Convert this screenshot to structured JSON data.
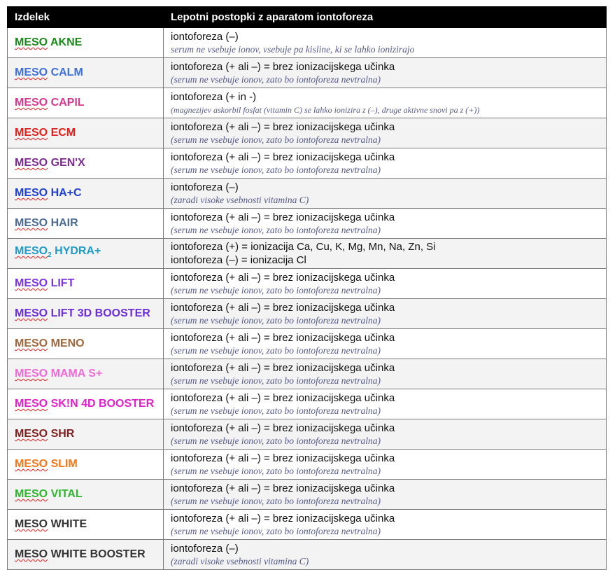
{
  "headers": {
    "col1": "Izdelek",
    "col2": "Lepotni postopki z aparatom iontoforeza"
  },
  "rows": [
    {
      "prefix": "MESO",
      "name": " AKNE",
      "color": "#1b8a1b",
      "line1": "iontoforeza (–)",
      "line2": "serum ne vsebuje ionov, vsebuje pa kisline, ki se lahko ionizirajo",
      "style": "plain"
    },
    {
      "prefix": "MESO",
      "name": " CALM",
      "color": "#3f6fd8",
      "line1": "iontoforeza (+ ali –) = brez ionizacijskega učinka",
      "line2": "(serum ne vsebuje ionov, zato bo iontoforeza nevtralna)",
      "style": "ital"
    },
    {
      "prefix": "MESO",
      "name": " CAPIL",
      "color": "#d6388f",
      "line1": "iontoforeza (+ in -)",
      "line2": "(magnezijev askorbil fosfat (vitamin C) se lahko ionizira z (–), druge aktivne snovi pa z (+))",
      "style": "small"
    },
    {
      "prefix": "MESO",
      "name": " ECM",
      "color": "#e0231d",
      "line1": "iontoforeza (+ ali –) = brez ionizacijskega učinka",
      "line2": "(serum ne vsebuje ionov, zato bo iontoforeza nevtralna)",
      "style": "ital"
    },
    {
      "prefix": "MESO",
      "name": " GEN'X",
      "color": "#7b2a8f",
      "line1": "iontoforeza (+ ali –) = brez ionizacijskega učinka",
      "line2": "(serum ne vsebuje ionov, zato bo iontoforeza nevtralna)",
      "style": "ital"
    },
    {
      "prefix": "MESO",
      "name": " HA+C",
      "color": "#1f3fd1",
      "line1": "iontoforeza (–)",
      "line2": "(zaradi visoke vsebnosti vitamina C)",
      "style": "ital"
    },
    {
      "prefix": "MESO",
      "name": " HAIR",
      "color": "#4a6b93",
      "line1": "iontoforeza (+ ali –) = brez ionizacijskega učinka",
      "line2": "(serum ne vsebuje ionov, zato bo iontoforeza nevtralna)",
      "style": "ital"
    },
    {
      "prefix": "MESO",
      "sub": "2",
      "name": " HYDRA+",
      "color": "#1f9bc6",
      "line1": "iontoforeza (+) = ionizacija Ca, Cu, K, Mg, Mn, Na, Zn, Si",
      "line2": "iontoforeza (–) = ionizacija Cl",
      "style": "normal"
    },
    {
      "prefix": "MESO",
      "name": " LIFT",
      "color": "#7a35e0",
      "line1": "iontoforeza (+ ali –) = brez ionizacijskega učinka",
      "line2": "(serum ne vsebuje ionov, zato bo iontoforeza nevtralna)",
      "style": "ital"
    },
    {
      "prefix": "MESO",
      "name": " LIFT 3D BOOSTER",
      "color": "#6b2fd8",
      "line1": "iontoforeza (+ ali –) = brez ionizacijskega učinka",
      "line2": "(serum ne vsebuje ionov, zato bo iontoforeza nevtralna)",
      "style": "ital"
    },
    {
      "prefix": "MESO",
      "name": " MENO",
      "color": "#a0673c",
      "line1": "iontoforeza (+ ali –) = brez ionizacijskega učinka",
      "line2": "(serum ne vsebuje ionov, zato bo iontoforeza nevtralna)",
      "style": "ital"
    },
    {
      "prefix": "MESO",
      "name": " MAMA S+",
      "color": "#f06ad8",
      "line1": "iontoforeza (+ ali –) = brez ionizacijskega učinka",
      "line2": "(serum ne vsebuje ionov, zato bo iontoforeza nevtralna)",
      "style": "ital"
    },
    {
      "prefix": "MESO",
      "name": " SK!N 4D BOOSTER",
      "color": "#e020c8",
      "line1": "iontoforeza (+ ali –) = brez ionizacijskega učinka",
      "line2": "(serum ne vsebuje ionov, zato bo iontoforeza nevtralna)",
      "style": "ital"
    },
    {
      "prefix": "MESO",
      "name": " SHR",
      "color": "#7e1f1f",
      "line1": "iontoforeza (+ ali –) = brez ionizacijskega učinka",
      "line2": "(serum ne vsebuje ionov, zato bo iontoforeza nevtralna)",
      "style": "ital"
    },
    {
      "prefix": "MESO",
      "name": " SLIM",
      "color": "#f2781b",
      "line1": "iontoforeza (+ ali –) = brez ionizacijskega učinka",
      "line2": "(serum ne vsebuje ionov, zato bo iontoforeza nevtralna)",
      "style": "ital"
    },
    {
      "prefix": "MESO",
      "name": " VITAL",
      "color": "#2fb52f",
      "line1": "iontoforeza (+ ali –) = brez ionizacijskega učinka",
      "line2": "(serum ne vsebuje ionov, zato bo iontoforeza nevtralna)",
      "style": "ital"
    },
    {
      "prefix": "MESO",
      "name": " WHITE",
      "color": "#333333",
      "line1": "iontoforeza (+ ali –) = brez ionizacijskega učinka",
      "line2": "(serum ne vsebuje ionov, zato bo iontoforeza nevtralna)",
      "style": "ital"
    },
    {
      "prefix": "MESO",
      "name": " WHITE BOOSTER",
      "color": "#333333",
      "line1": "iontoforeza (–)",
      "line2": "(zaradi visoke vsebnosti vitamina C)",
      "style": "ital"
    }
  ]
}
